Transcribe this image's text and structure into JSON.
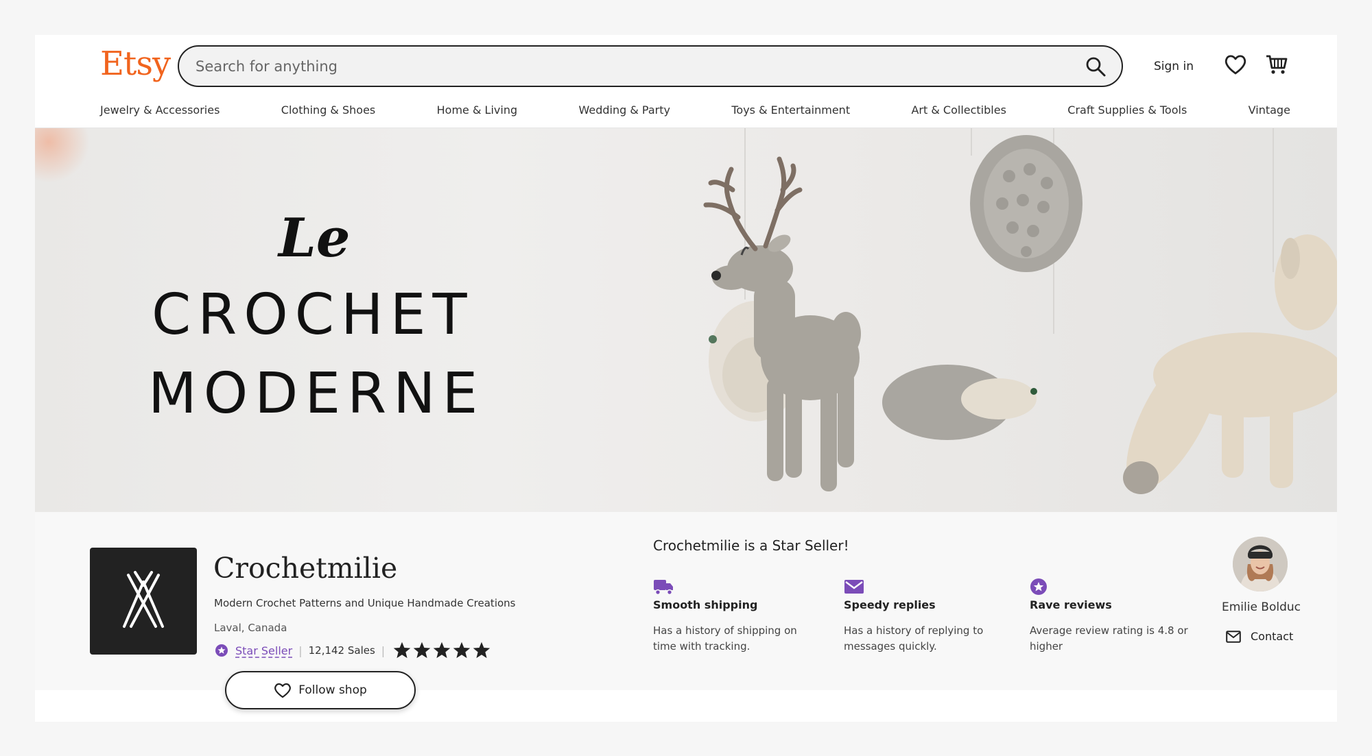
{
  "header": {
    "logo": "Etsy",
    "search_placeholder": "Search for anything",
    "sign_in": "Sign in"
  },
  "categories": [
    "Jewelry & Accessories",
    "Clothing & Shoes",
    "Home & Living",
    "Wedding & Party",
    "Toys & Entertainment",
    "Art & Collectibles",
    "Craft Supplies & Tools",
    "Vintage"
  ],
  "banner": {
    "line_le": "Le",
    "line_1": "CROCHET",
    "line_2": "MODERNE"
  },
  "shop": {
    "name": "Crochetmilie",
    "description": "Modern Crochet Patterns and Unique Handmade Creations",
    "location": "Laval, Canada",
    "badge": "Star Seller",
    "sales": "12,142 Sales",
    "rating_stars": 5,
    "follow_label": "Follow shop"
  },
  "star_seller": {
    "heading": "Crochetmilie is a Star Seller!",
    "perks": [
      {
        "icon": "truck-icon",
        "title": "Smooth shipping",
        "desc": "Has a history of shipping on time with tracking."
      },
      {
        "icon": "envelope-icon",
        "title": "Speedy replies",
        "desc": "Has a history of replying to messages quickly."
      },
      {
        "icon": "star-badge-icon",
        "title": "Rave reviews",
        "desc": "Average review rating is 4.8 or higher"
      }
    ]
  },
  "owner": {
    "name": "Emilie Bolduc",
    "contact_label": "Contact"
  },
  "colors": {
    "brand": "#f1641e",
    "star_seller": "#7b4cb8",
    "text": "#222222"
  }
}
